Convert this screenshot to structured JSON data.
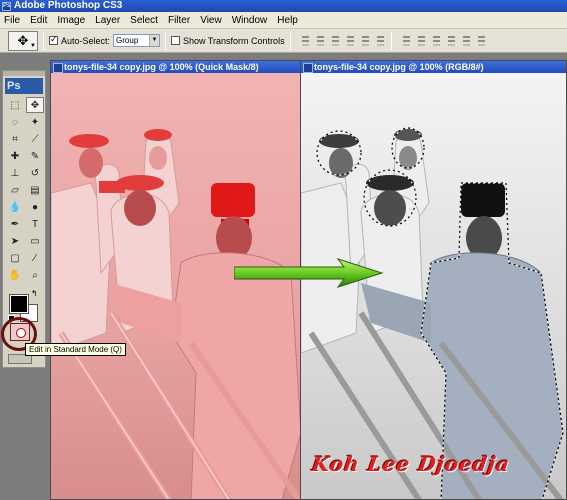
{
  "app": {
    "title": "Adobe Photoshop CS3"
  },
  "menu": [
    "File",
    "Edit",
    "Image",
    "Layer",
    "Select",
    "Filter",
    "View",
    "Window",
    "Help"
  ],
  "options": {
    "auto_select_label": "Auto-Select:",
    "auto_select_checked": true,
    "auto_select_value": "Group",
    "show_transform_label": "Show Transform Controls",
    "show_transform_checked": false
  },
  "toolbox": {
    "logo": "Ps",
    "tools": [
      "marquee",
      "move",
      "lasso",
      "magic-wand",
      "crop",
      "slice",
      "healing",
      "brush",
      "stamp",
      "history-brush",
      "eraser",
      "gradient",
      "blur",
      "dodge",
      "pen",
      "type",
      "path-select",
      "shape",
      "notes",
      "eyedropper",
      "hand",
      "zoom"
    ],
    "colors": {
      "foreground": "#000000",
      "background": "#ffffff"
    },
    "tooltip": "Edit in Standard Mode (Q)"
  },
  "documents": [
    {
      "title": "tonys-file-34 copy.jpg @ 100% (Quick Mask/8)",
      "mode": "quick-mask"
    },
    {
      "title": "tonys-file-34 copy.jpg @ 100% (RGB/8#)",
      "mode": "rgb-selection"
    }
  ],
  "signature": "Koh Lee Djoedja",
  "colors": {
    "quick_mask_tint": "#f0a0a0",
    "arrow": "#66cc22",
    "signature": "#e02020"
  }
}
